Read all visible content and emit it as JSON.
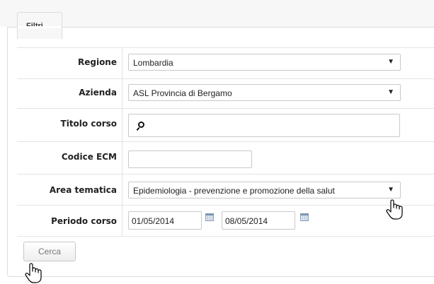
{
  "filters": {
    "tab_label": "Filtri",
    "regione": {
      "label": "Regione",
      "value": "Lombardia"
    },
    "azienda": {
      "label": "Azienda",
      "value": "ASL Provincia di Bergamo"
    },
    "titolo_corso": {
      "label": "Titolo corso",
      "value": ""
    },
    "codice_ecm": {
      "label": "Codice ECM",
      "value": ""
    },
    "area_tematica": {
      "label": "Area tematica",
      "value": "Epidemiologia - prevenzione e promozione della salut"
    },
    "periodo_corso": {
      "label": "Periodo corso",
      "from": "01/05/2014",
      "to": "08/05/2014"
    },
    "search_button": "Cerca"
  },
  "icons": {
    "dropdown_arrow": "▼"
  }
}
